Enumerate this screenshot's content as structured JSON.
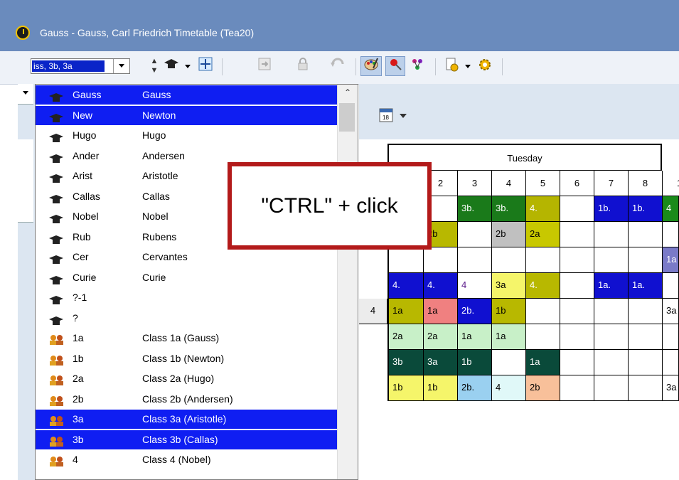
{
  "window": {
    "title": "Gauss - Gauss, Carl Friedrich  Timetable  (Tea20)"
  },
  "toolbar": {
    "selector_value": "iss, 3b, 3a"
  },
  "dropdown": {
    "items": [
      {
        "code": "Gauss",
        "name": "Gauss",
        "type": "teacher",
        "selected": true
      },
      {
        "code": "New",
        "name": "Newton",
        "type": "teacher",
        "selected": true
      },
      {
        "code": "Hugo",
        "name": "Hugo",
        "type": "teacher",
        "selected": false
      },
      {
        "code": "Ander",
        "name": "Andersen",
        "type": "teacher",
        "selected": false
      },
      {
        "code": "Arist",
        "name": "Aristotle",
        "type": "teacher",
        "selected": false
      },
      {
        "code": "Callas",
        "name": "Callas",
        "type": "teacher",
        "selected": false
      },
      {
        "code": "Nobel",
        "name": "Nobel",
        "type": "teacher",
        "selected": false
      },
      {
        "code": "Rub",
        "name": "Rubens",
        "type": "teacher",
        "selected": false
      },
      {
        "code": "Cer",
        "name": "Cervantes",
        "type": "teacher",
        "selected": false
      },
      {
        "code": "Curie",
        "name": "Curie",
        "type": "teacher",
        "selected": false
      },
      {
        "code": "?-1",
        "name": "",
        "type": "teacher",
        "selected": false
      },
      {
        "code": "?",
        "name": "",
        "type": "teacher",
        "selected": false
      },
      {
        "code": "1a",
        "name": "Class 1a (Gauss)",
        "type": "class",
        "selected": false
      },
      {
        "code": "1b",
        "name": "Class 1b (Newton)",
        "type": "class",
        "selected": false
      },
      {
        "code": "2a",
        "name": "Class 2a (Hugo)",
        "type": "class",
        "selected": false
      },
      {
        "code": "2b",
        "name": "Class 2b (Andersen)",
        "type": "class",
        "selected": false
      },
      {
        "code": "3a",
        "name": "Class 3a (Aristotle)",
        "type": "class",
        "selected": true
      },
      {
        "code": "3b",
        "name": "Class 3b (Callas)",
        "type": "class",
        "selected": true
      },
      {
        "code": "4",
        "name": "Class 4 (Nobel)",
        "type": "class",
        "selected": false
      }
    ]
  },
  "callout": {
    "text": "\"CTRL\" + click"
  },
  "timetable": {
    "day": "Tuesday",
    "periods": [
      "2",
      "3",
      "4",
      "5",
      "6",
      "7",
      "8",
      "1"
    ],
    "rows": [
      [
        {
          "t": "",
          "c": "#ffffff"
        },
        {
          "t": "3b.",
          "c": "#1a7a1a",
          "fg": "#ffffff"
        },
        {
          "t": "3b.",
          "c": "#1a7a1a",
          "fg": "#ffffff"
        },
        {
          "t": "4.",
          "c": "#b5b500",
          "fg": "#ffffff"
        },
        {
          "t": "",
          "c": "#ffffff"
        },
        {
          "t": "1b.",
          "c": "#1010d0",
          "fg": "#ffffff"
        },
        {
          "t": "1b.",
          "c": "#1010d0",
          "fg": "#ffffff"
        },
        {
          "t": "4",
          "c": "#1a8a1a",
          "fg": "#ffffff"
        }
      ],
      [
        {
          "t": "2b",
          "c": "#b8b800"
        },
        {
          "t": "",
          "c": "#ffffff"
        },
        {
          "t": "2b",
          "c": "#c0c0c0"
        },
        {
          "t": "2a",
          "c": "#c8c800"
        },
        {
          "t": "",
          "c": "#ffffff"
        },
        {
          "t": "",
          "c": "#ffffff"
        },
        {
          "t": "",
          "c": "#ffffff"
        },
        {
          "t": "",
          "c": "#ffffff"
        }
      ],
      [
        {
          "t": "",
          "c": "#ffffff"
        },
        {
          "t": "",
          "c": "#ffffff"
        },
        {
          "t": "",
          "c": "#ffffff"
        },
        {
          "t": "",
          "c": "#ffffff"
        },
        {
          "t": "",
          "c": "#ffffff"
        },
        {
          "t": "",
          "c": "#ffffff"
        },
        {
          "t": "",
          "c": "#ffffff"
        },
        {
          "t": "1a",
          "c": "#7a7ac8",
          "fg": "#ffffff"
        }
      ],
      [
        {
          "t": "4.",
          "c": "#1010d0",
          "fg": "#ffffff"
        },
        {
          "t": "4",
          "c": "#ffffff",
          "fg": "#5a1a8a"
        },
        {
          "t": "3a",
          "c": "#f5f56a"
        },
        {
          "t": "4.",
          "c": "#b8b800",
          "fg": "#ffffff"
        },
        {
          "t": "",
          "c": "#ffffff"
        },
        {
          "t": "1a.",
          "c": "#1010d0",
          "fg": "#ffffff"
        },
        {
          "t": "1a.",
          "c": "#1010d0",
          "fg": "#ffffff"
        },
        {
          "t": "",
          "c": "#ffffff"
        }
      ],
      [
        {
          "t": "1a",
          "c": "#f08080"
        },
        {
          "t": "2b.",
          "c": "#1010d0",
          "fg": "#ffffff"
        },
        {
          "t": "1b",
          "c": "#b8b800"
        },
        {
          "t": "",
          "c": "#ffffff"
        },
        {
          "t": "",
          "c": "#ffffff"
        },
        {
          "t": "",
          "c": "#ffffff"
        },
        {
          "t": "",
          "c": "#ffffff"
        },
        {
          "t": "3a",
          "c": "#ffffff"
        }
      ],
      [
        {
          "t": "2a",
          "c": "#c8f0c8"
        },
        {
          "t": "1a",
          "c": "#c8f0c8"
        },
        {
          "t": "1a",
          "c": "#c8f0c8"
        },
        {
          "t": "",
          "c": "#ffffff"
        },
        {
          "t": "",
          "c": "#ffffff"
        },
        {
          "t": "",
          "c": "#ffffff"
        },
        {
          "t": "",
          "c": "#ffffff"
        },
        {
          "t": "",
          "c": "#ffffff"
        }
      ],
      [
        {
          "t": "3a",
          "c": "#0a4a3a",
          "fg": "#ffffff"
        },
        {
          "t": "1b",
          "c": "#0a4a3a",
          "fg": "#ffffff"
        },
        {
          "t": "",
          "c": "#ffffff"
        },
        {
          "t": "1a",
          "c": "#0a4a3a",
          "fg": "#ffffff"
        },
        {
          "t": "",
          "c": "#ffffff"
        },
        {
          "t": "",
          "c": "#ffffff"
        },
        {
          "t": "",
          "c": "#ffffff"
        },
        {
          "t": "",
          "c": "#ffffff"
        }
      ],
      [
        {
          "t": "1b",
          "c": "#f5f56a"
        },
        {
          "t": "2b.",
          "c": "#9ad0f0"
        },
        {
          "t": "4",
          "c": "#e0f8f8"
        },
        {
          "t": "2b",
          "c": "#f8c09a"
        },
        {
          "t": "",
          "c": "#ffffff"
        },
        {
          "t": "",
          "c": "#ffffff"
        },
        {
          "t": "",
          "c": "#ffffff"
        },
        {
          "t": "3a",
          "c": "#ffffff"
        }
      ]
    ],
    "col1_rows": [
      {
        "t": "",
        "c": "#ffffff"
      },
      {
        "t": "2b",
        "c": "#b8b800"
      },
      {
        "t": "",
        "c": "#ffffff"
      },
      {
        "t": "4.",
        "c": "#1010d0",
        "fg": "#ffffff"
      },
      {
        "t": "1a",
        "c": "#b8b800"
      },
      {
        "t": "2a",
        "c": "#c8f0c8"
      },
      {
        "t": "3b",
        "c": "#0a4a3a",
        "fg": "#ffffff"
      },
      {
        "t": "1b",
        "c": "#f5f56a"
      }
    ],
    "left_col_value": "4"
  }
}
